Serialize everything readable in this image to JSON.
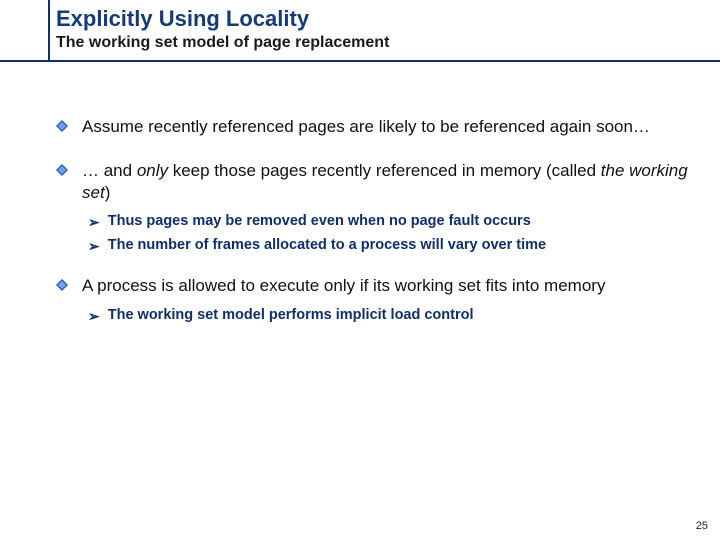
{
  "header": {
    "title": "Explicitly Using Locality",
    "subtitle": "The working set model of page replacement"
  },
  "bullets": {
    "p1": "Assume recently referenced pages are likely to be referenced again soon…",
    "p2a": "… and ",
    "p2b": "only",
    "p2c": " keep those pages recently referenced in memory (called ",
    "p2d": "the working set",
    "p2e": ")",
    "p2_s1": "Thus pages may be removed even when no page fault occurs",
    "p2_s2": "The number of frames allocated to a process will vary over time",
    "p3": "A process is allowed to execute only if its working set fits into memory",
    "p3_s1": "The working set model performs implicit load control"
  },
  "page_number": "25"
}
